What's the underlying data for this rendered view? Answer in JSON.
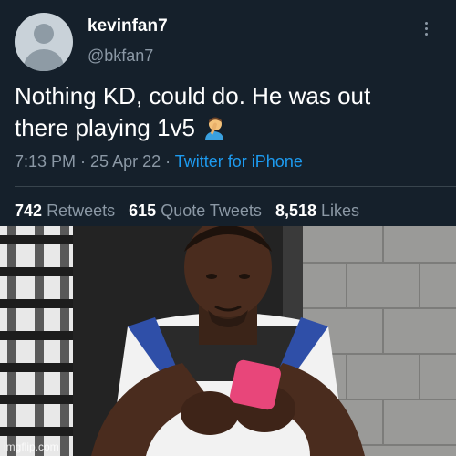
{
  "tweet": {
    "display_name": "kevinfan7",
    "handle": "@bkfan7",
    "text_line1": "Nothing KD, could do. He was out",
    "text_line2": "there playing 1v5",
    "emoji": "facepalm-emoji",
    "time": "7:13 PM",
    "date": "25 Apr 22",
    "separator": " · ",
    "source": "Twitter for iPhone",
    "stats": {
      "retweets_count": "742",
      "retweets_label": "Retweets",
      "quotes_count": "615",
      "quotes_label": "Quote Tweets",
      "likes_count": "8,518",
      "likes_label": "Likes"
    }
  },
  "photo": {
    "watermark": "imgflip.com"
  },
  "colors": {
    "background": "#15202b",
    "text": "#ffffff",
    "secondary": "#8b98a5",
    "link": "#1d9bf0",
    "divider": "#38444d"
  }
}
